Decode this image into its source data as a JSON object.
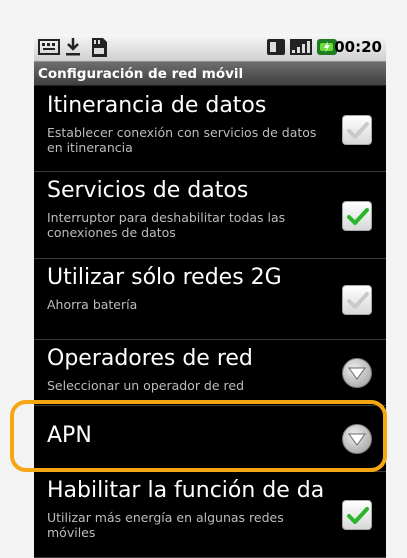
{
  "status_bar": {
    "time": "00:20",
    "left_icons": [
      "keyboard-icon",
      "download-icon",
      "sd-card-icon"
    ],
    "right_icons": [
      "phone-data-icon",
      "signal-icon",
      "battery-charging-icon"
    ]
  },
  "title_bar": {
    "title": "Configuración de red móvil"
  },
  "settings": [
    {
      "title": "Itinerancia de datos",
      "subtitle": "Establecer conexión con servicios de datos en itinerancia",
      "control": "checkbox",
      "checked": false
    },
    {
      "title": "Servicios de datos",
      "subtitle": "Interruptor para deshabilitar todas las conexiones de datos",
      "control": "checkbox",
      "checked": true
    },
    {
      "title": "Utilizar sólo redes 2G",
      "subtitle": "Ahorra batería",
      "control": "checkbox",
      "checked": false
    },
    {
      "title": "Operadores de red",
      "subtitle": "Seleccionar un operador de red",
      "control": "arrow"
    },
    {
      "title": "APN",
      "subtitle": "",
      "control": "arrow"
    },
    {
      "title": "Habilitar la función de da",
      "subtitle": "Utilizar más energía en algunas redes móviles",
      "control": "checkbox",
      "checked": true
    }
  ],
  "colors": {
    "highlight": "#f5a712",
    "check_green": "#2bb52b",
    "background": "#000000"
  }
}
